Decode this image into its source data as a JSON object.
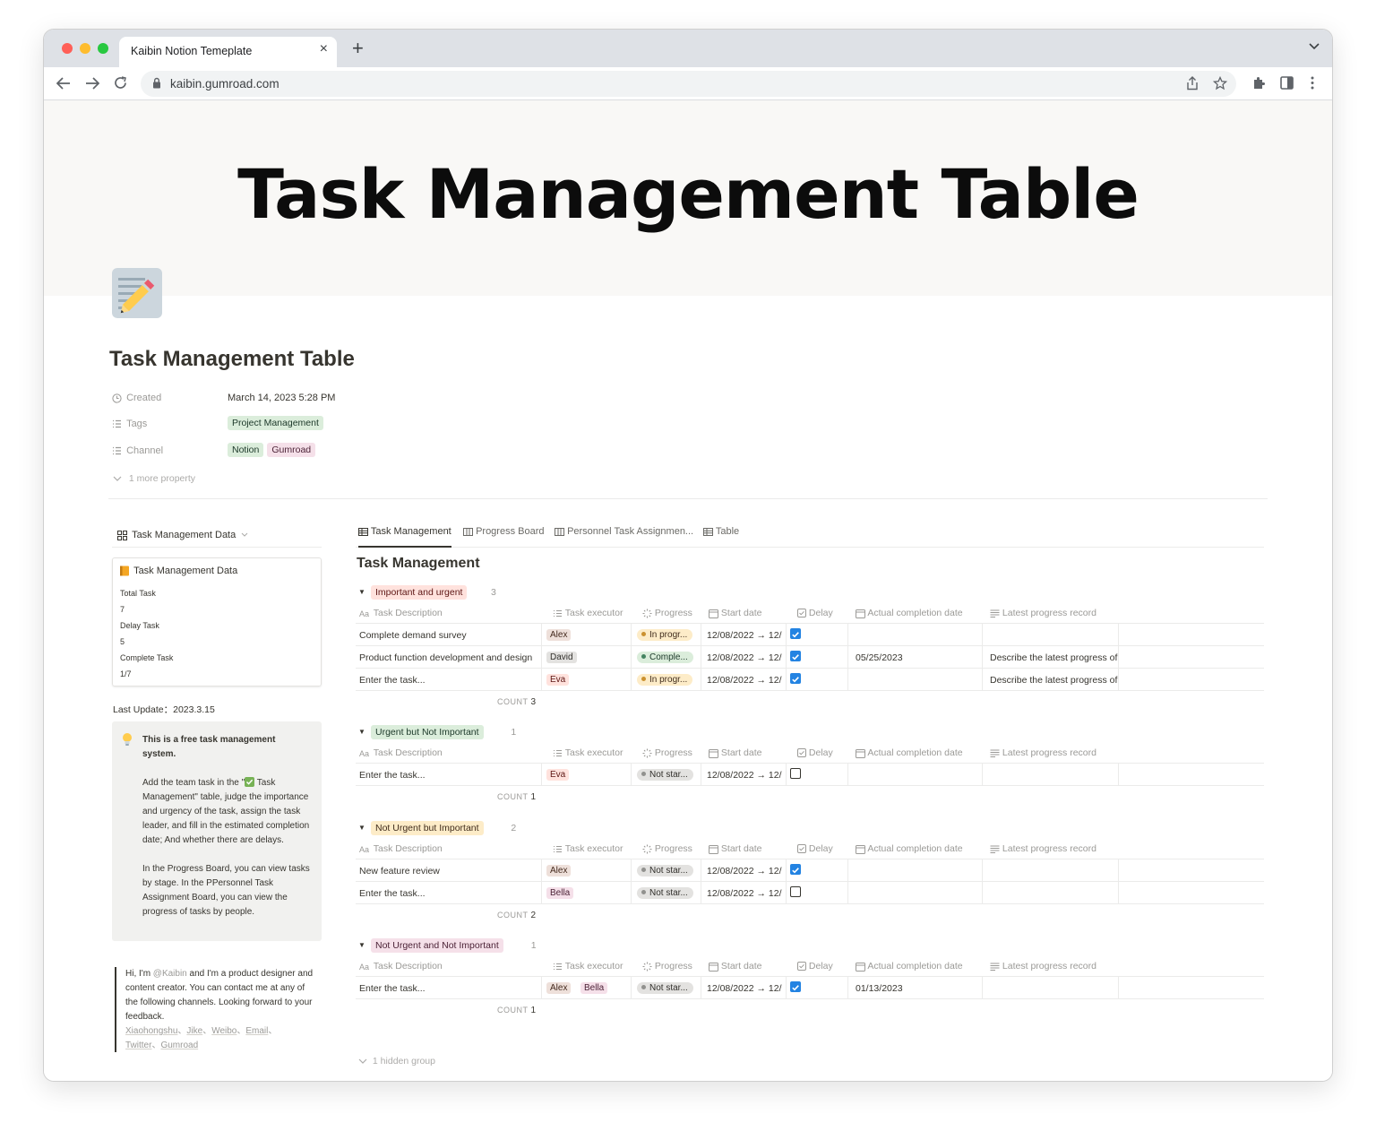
{
  "browser": {
    "tab_title": "Kaibin Notion Temeplate",
    "url": "kaibin.gumroad.com"
  },
  "cover": {
    "text": "Task Management Table"
  },
  "page": {
    "title": "Task Management Table",
    "properties": {
      "created_label": "Created",
      "created_value": "March 14, 2023 5:28 PM",
      "tags_label": "Tags",
      "tags": [
        "Project Management"
      ],
      "channel_label": "Channel",
      "channels": [
        "Notion",
        "Gumroad"
      ],
      "more": "1 more property"
    }
  },
  "sidebar": {
    "header": "Task Management Data",
    "card": {
      "title": "Task Management Data",
      "lines": [
        "Total Task",
        "7",
        "Delay Task",
        "5",
        "Complete Task",
        "1/7"
      ]
    },
    "last_update": "Last Update：2023.3.15",
    "callout": {
      "bold": "This is a free task management system.",
      "para1_a": "Add the team task in the \"",
      "para1_b": " Task Management\" table, judge the importance and urgency of the task, assign the task leader, and fill in the estimated completion date; And whether there are delays.",
      "para2": "In the Progress Board, you can view tasks by stage. In the PPersonnel Task Assignment Board, you can view the progress of tasks by people."
    },
    "quote": {
      "a": "Hi, I'm ",
      "handle": "@Kaibin",
      "b": " and I'm a product designer and content creator. You can contact me at any of the following channels. Looking forward to your feedback.",
      "links": [
        "Xiaohongshu",
        "Jike",
        "Weibo",
        "Email",
        "Twitter",
        "Gumroad"
      ],
      "sep": "、"
    }
  },
  "database": {
    "views": [
      "Task Management",
      "Progress Board",
      "Personnel Task Assignmen...",
      "Table"
    ],
    "title": "Task Management",
    "columns": [
      "Task Description",
      "Task executor",
      "Progress",
      "Start date",
      "Delay",
      "Actual completion date",
      "Latest progress record"
    ],
    "count_label": "COUNT",
    "hidden_groups": "1 hidden group",
    "groups": [
      {
        "name": "Important and urgent",
        "count": "3",
        "rows": [
          {
            "task": "Complete demand survey",
            "executors": [
              "Alex"
            ],
            "progress": "In progr...",
            "start": "12/08/2022 → 12/",
            "delay": true,
            "actual": "",
            "latest": ""
          },
          {
            "task": "Product function development and design",
            "executors": [
              "David"
            ],
            "progress": "Comple...",
            "start": "12/08/2022 → 12/",
            "delay": true,
            "actual": "05/25/2023",
            "latest": "Describe the latest progress of"
          },
          {
            "task": "Enter the task...",
            "executors": [
              "Eva"
            ],
            "progress": "In progr...",
            "start": "12/08/2022 → 12/",
            "delay": true,
            "actual": "",
            "latest": "Describe the latest progress of"
          }
        ]
      },
      {
        "name": "Urgent but Not Important",
        "count": "1",
        "rows": [
          {
            "task": "Enter the task...",
            "executors": [
              "Eva"
            ],
            "progress": "Not star...",
            "start": "12/08/2022 → 12/",
            "delay": false,
            "actual": "",
            "latest": ""
          }
        ]
      },
      {
        "name": "Not Urgent but Important",
        "count": "2",
        "rows": [
          {
            "task": "New feature review",
            "executors": [
              "Alex"
            ],
            "progress": "Not star...",
            "start": "12/08/2022 → 12/",
            "delay": true,
            "actual": "",
            "latest": ""
          },
          {
            "task": "Enter the task...",
            "executors": [
              "Bella"
            ],
            "progress": "Not star...",
            "start": "12/08/2022 → 12/",
            "delay": false,
            "actual": "",
            "latest": ""
          }
        ]
      },
      {
        "name": "Not Urgent and Not Important",
        "count": "1",
        "rows": [
          {
            "task": "Enter the task...",
            "executors": [
              "Alex",
              "Bella"
            ],
            "progress": "Not star...",
            "start": "12/08/2022 → 12/",
            "delay": true,
            "actual": "01/13/2023",
            "latest": ""
          }
        ]
      }
    ]
  },
  "colors": {
    "group_important_urgent": "#ffe2dd",
    "group_urgent_not_important": "#dbeddb",
    "group_not_urgent_important": "#fdecc8",
    "group_not_urgent_not_important": "#f5e0e9",
    "status_in_progress": "#fdecc8",
    "status_complete": "#dbeddb",
    "status_not_started": "#e3e2e0",
    "checkbox_on": "#2383e2"
  }
}
